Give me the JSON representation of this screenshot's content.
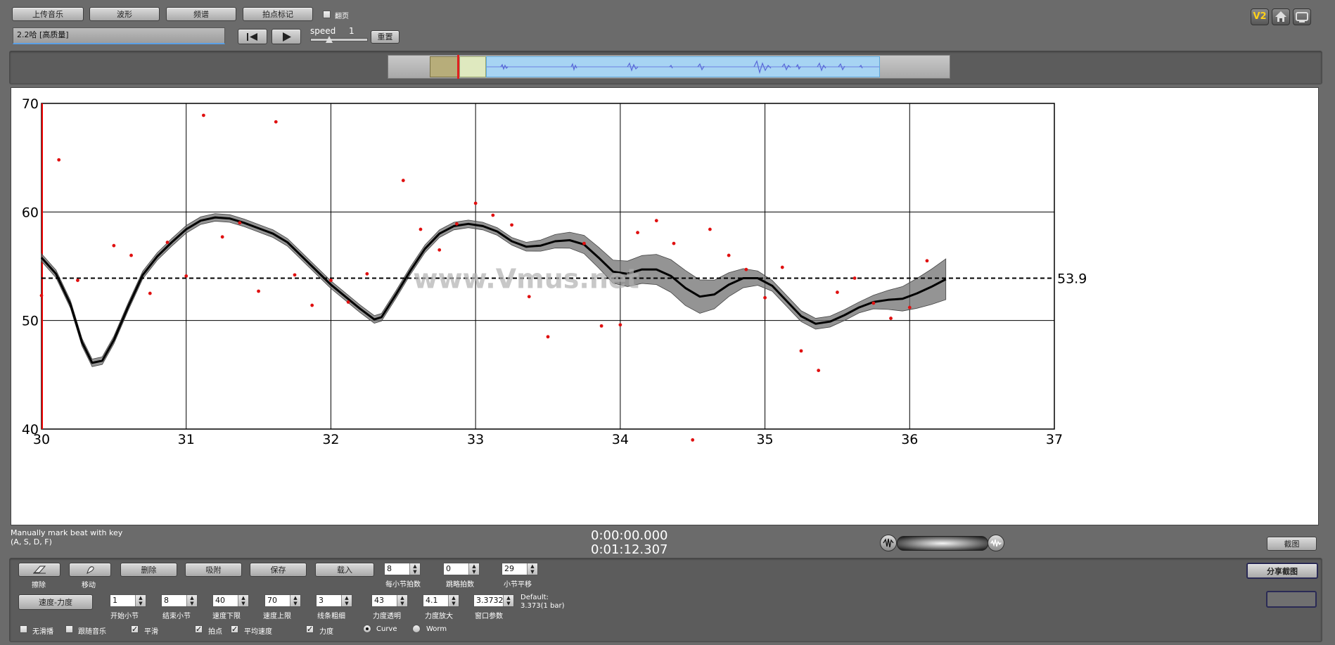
{
  "toolbar": {
    "upload_label": "上传音乐",
    "waveform_label": "波形",
    "spectrum_label": "频谱",
    "beat_mark_label": "拍点标记",
    "flip_label": "翻页",
    "track_name": "2.2哈 [高质量]",
    "speed_label": "speed",
    "speed_value": "1",
    "reset_label": "重置"
  },
  "top_right": {
    "v2_label": "V2"
  },
  "chart_data": {
    "type": "scatter",
    "xlim": [
      30,
      37
    ],
    "ylim": [
      40,
      70
    ],
    "x_ticks": [
      "30",
      "31",
      "32",
      "33",
      "34",
      "35",
      "36",
      "37"
    ],
    "y_ticks": [
      "40",
      "50",
      "60",
      "70"
    ],
    "mean_value": 53.9,
    "mean_label": "53.9",
    "watermark": "www.Vmus.net",
    "grid": true,
    "points": [
      [
        30.0,
        52.3
      ],
      [
        30.12,
        64.8
      ],
      [
        30.25,
        53.7
      ],
      [
        30.5,
        56.9
      ],
      [
        30.62,
        56.0
      ],
      [
        30.75,
        52.5
      ],
      [
        30.87,
        57.2
      ],
      [
        31.0,
        54.1
      ],
      [
        31.12,
        68.9
      ],
      [
        31.25,
        57.7
      ],
      [
        31.37,
        59.0
      ],
      [
        31.5,
        52.7
      ],
      [
        31.62,
        68.3
      ],
      [
        31.75,
        54.2
      ],
      [
        31.87,
        51.4
      ],
      [
        32.0,
        53.7
      ],
      [
        32.12,
        51.7
      ],
      [
        32.25,
        54.3
      ],
      [
        32.5,
        62.9
      ],
      [
        32.62,
        58.4
      ],
      [
        32.75,
        56.5
      ],
      [
        32.87,
        58.9
      ],
      [
        33.0,
        60.8
      ],
      [
        33.12,
        59.7
      ],
      [
        33.25,
        58.8
      ],
      [
        33.37,
        52.2
      ],
      [
        33.5,
        48.5
      ],
      [
        33.75,
        57.1
      ],
      [
        33.87,
        49.5
      ],
      [
        34.0,
        49.6
      ],
      [
        34.12,
        58.1
      ],
      [
        34.25,
        59.2
      ],
      [
        34.37,
        57.1
      ],
      [
        34.5,
        39.0
      ],
      [
        34.62,
        58.4
      ],
      [
        34.75,
        56.0
      ],
      [
        34.87,
        54.7
      ],
      [
        35.0,
        52.1
      ],
      [
        35.12,
        54.9
      ],
      [
        35.25,
        47.2
      ],
      [
        35.37,
        45.4
      ],
      [
        35.5,
        52.6
      ],
      [
        35.62,
        53.9
      ],
      [
        35.75,
        51.6
      ],
      [
        35.87,
        50.2
      ],
      [
        36.0,
        51.2
      ],
      [
        36.12,
        55.5
      ]
    ],
    "smooth_curve": [
      [
        30.0,
        55.8
      ],
      [
        30.1,
        54.3
      ],
      [
        30.2,
        51.5
      ],
      [
        30.28,
        48.0
      ],
      [
        30.35,
        46.1
      ],
      [
        30.42,
        46.3
      ],
      [
        30.5,
        48.2
      ],
      [
        30.6,
        51.3
      ],
      [
        30.7,
        54.2
      ],
      [
        30.8,
        55.9
      ],
      [
        30.9,
        57.2
      ],
      [
        31.0,
        58.4
      ],
      [
        31.1,
        59.2
      ],
      [
        31.2,
        59.5
      ],
      [
        31.3,
        59.4
      ],
      [
        31.4,
        59.0
      ],
      [
        31.5,
        58.5
      ],
      [
        31.6,
        58.0
      ],
      [
        31.7,
        57.2
      ],
      [
        31.8,
        55.9
      ],
      [
        31.9,
        54.6
      ],
      [
        32.0,
        53.3
      ],
      [
        32.1,
        52.2
      ],
      [
        32.2,
        51.1
      ],
      [
        32.3,
        50.1
      ],
      [
        32.35,
        50.3
      ],
      [
        32.45,
        52.4
      ],
      [
        32.55,
        54.6
      ],
      [
        32.65,
        56.6
      ],
      [
        32.75,
        58.0
      ],
      [
        32.85,
        58.7
      ],
      [
        32.95,
        58.9
      ],
      [
        33.05,
        58.7
      ],
      [
        33.15,
        58.2
      ],
      [
        33.25,
        57.3
      ],
      [
        33.35,
        56.8
      ],
      [
        33.45,
        56.9
      ],
      [
        33.55,
        57.3
      ],
      [
        33.65,
        57.4
      ],
      [
        33.75,
        57.0
      ],
      [
        33.85,
        55.8
      ],
      [
        33.95,
        54.5
      ],
      [
        34.05,
        54.3
      ],
      [
        34.15,
        54.7
      ],
      [
        34.25,
        54.7
      ],
      [
        34.35,
        54.1
      ],
      [
        34.45,
        53.0
      ],
      [
        34.55,
        52.2
      ],
      [
        34.65,
        52.4
      ],
      [
        34.75,
        53.3
      ],
      [
        34.85,
        53.9
      ],
      [
        34.95,
        53.9
      ],
      [
        35.05,
        53.2
      ],
      [
        35.15,
        51.8
      ],
      [
        35.25,
        50.4
      ],
      [
        35.35,
        49.7
      ],
      [
        35.45,
        49.9
      ],
      [
        35.55,
        50.5
      ],
      [
        35.65,
        51.2
      ],
      [
        35.75,
        51.7
      ],
      [
        35.85,
        51.9
      ],
      [
        35.95,
        52.0
      ],
      [
        36.05,
        52.5
      ],
      [
        36.15,
        53.1
      ],
      [
        36.25,
        53.8
      ]
    ]
  },
  "status": {
    "hint_line1": "Manually mark beat with key",
    "hint_line2": "(A, S, D, F)",
    "time_current": "0:00:00.000",
    "time_total": "0:01:12.307",
    "screenshot_label": "截图",
    "share_label": "分享截图"
  },
  "controls": {
    "erase_label": "擦除",
    "move_label": "移动",
    "delete_label": "删除",
    "snap_label": "吸附",
    "save_label": "保存",
    "load_label": "载入",
    "beats_per_bar_value": "8",
    "beats_per_bar_label": "每小节拍数",
    "skip_beats_value": "0",
    "skip_beats_label": "跳略拍数",
    "bar_smooth_value": "29",
    "bar_smooth_label": "小节平移",
    "tempo_dynamics_label": "速度-力度",
    "start_bar_value": "1",
    "start_bar_label": "开始小节",
    "end_bar_value": "8",
    "end_bar_label": "结束小节",
    "tempo_min_value": "40",
    "tempo_min_label": "速度下限",
    "tempo_max_value": "70",
    "tempo_max_label": "速度上限",
    "line_width_value": "3",
    "line_width_label": "线条粗细",
    "dyn_transparency_value": "43",
    "dyn_transparency_label": "力度透明",
    "dyn_scale_value": "4.1",
    "dyn_scale_label": "力度放大",
    "window_param_value": "3.3732",
    "window_param_label": "窗口参数",
    "default_line1": "Default:",
    "default_line2": "3.373(1 bar)",
    "no_scroll_label": "无滑播",
    "follow_music_label": "跟随音乐",
    "smooth_label": "平滑",
    "beat_point_label": "拍点",
    "avg_tempo_label": "平均速度",
    "dynamics_label": "力度",
    "curve_label": "Curve",
    "worm_label": "Worm"
  }
}
